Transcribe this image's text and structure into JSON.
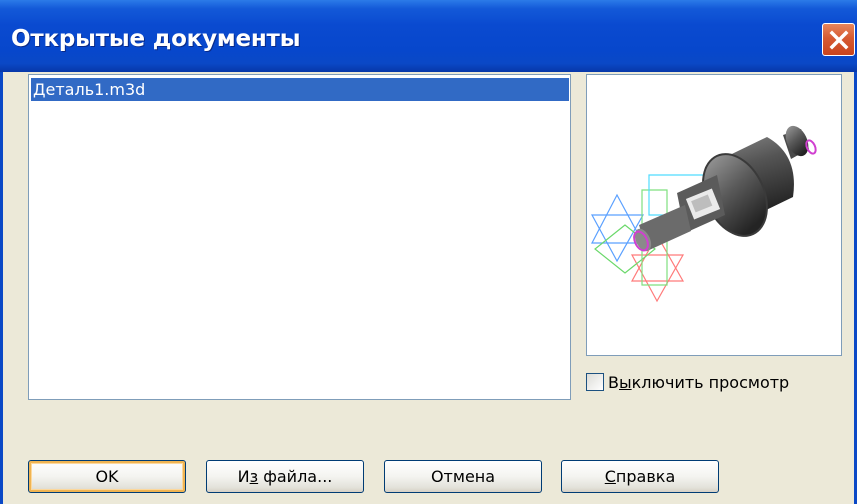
{
  "dialog": {
    "title": "Открытые документы",
    "close_icon": "close-x-icon"
  },
  "documents": {
    "items": [
      {
        "label": "Деталь1.m3d",
        "selected": true
      }
    ]
  },
  "preview": {
    "image": "3d-shaft-part-preview",
    "disable_checkbox": {
      "checked": false,
      "label_prefix": "В",
      "label_accel": "ы",
      "label_suffix": "ключить просмотр"
    }
  },
  "buttons": {
    "ok": {
      "label": "OK"
    },
    "from_file": {
      "prefix": "И",
      "accel": "з",
      "suffix": " файла..."
    },
    "cancel": {
      "label": "Отмена"
    },
    "help": {
      "prefix": "",
      "accel": "С",
      "suffix": "правка"
    }
  },
  "colors": {
    "titlebar": "#0a48c6",
    "selection": "#316ac5",
    "close_button": "#d65a32",
    "dialog_bg": "#ece9d8"
  }
}
